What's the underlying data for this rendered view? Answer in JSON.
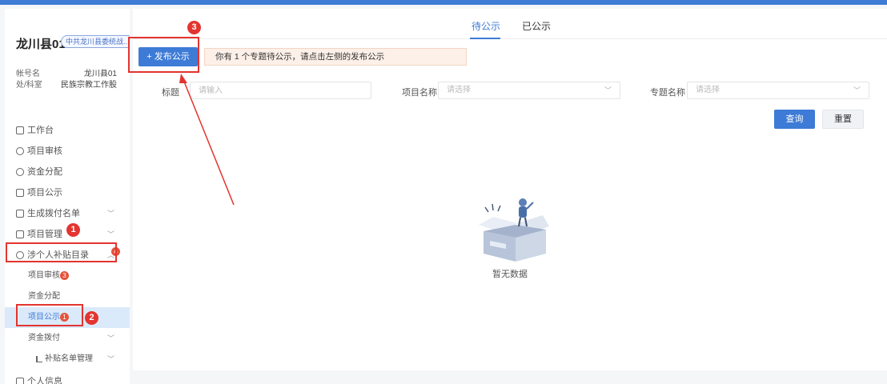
{
  "sidebar": {
    "county": "龙川县01",
    "org": "中共龙川县委统战...",
    "account_label": "帐号名",
    "account_value": "龙川县01",
    "dept_label": "处/科室",
    "dept_value": "民族宗教工作股",
    "menu": [
      {
        "label": "工作台",
        "icon": "monitor-icon"
      },
      {
        "label": "项目审核",
        "icon": "user-check-icon"
      },
      {
        "label": "资金分配",
        "icon": "coin-icon"
      },
      {
        "label": "项目公示",
        "icon": "calendar-icon"
      },
      {
        "label": "生成拨付名单",
        "icon": "checklist-icon"
      },
      {
        "label": "项目管理",
        "icon": "sitemap-icon"
      },
      {
        "label": "涉个人补贴目录",
        "icon": "circle-loading-icon"
      }
    ],
    "submenu": [
      {
        "label": "项目审核",
        "badge": "3"
      },
      {
        "label": "资金分配",
        "badge": ""
      },
      {
        "label": "项目公示",
        "badge": "1"
      },
      {
        "label": "资金拨付",
        "badge": ""
      },
      {
        "label": "补贴名单管理",
        "badge": ""
      }
    ],
    "menu_badge": "4",
    "last_item": "个人信息"
  },
  "tabs": [
    "待公示",
    "已公示"
  ],
  "toolbar": {
    "publish_button": "+ 发布公示",
    "notice": "你有 1 个专题待公示，请点击左侧的发布公示"
  },
  "filters": {
    "title_label": "标题",
    "title_placeholder": "请输入",
    "project_label": "项目名称",
    "project_placeholder": "请选择",
    "topic_label": "专题名称",
    "topic_placeholder": "请选择"
  },
  "actions": {
    "query": "查询",
    "reset": "重置"
  },
  "empty": {
    "text": "暂无数据"
  },
  "annotations": [
    "1",
    "2",
    "3"
  ],
  "colors": {
    "accent": "#3d7bd6",
    "annotation_red": "#e3342f"
  }
}
